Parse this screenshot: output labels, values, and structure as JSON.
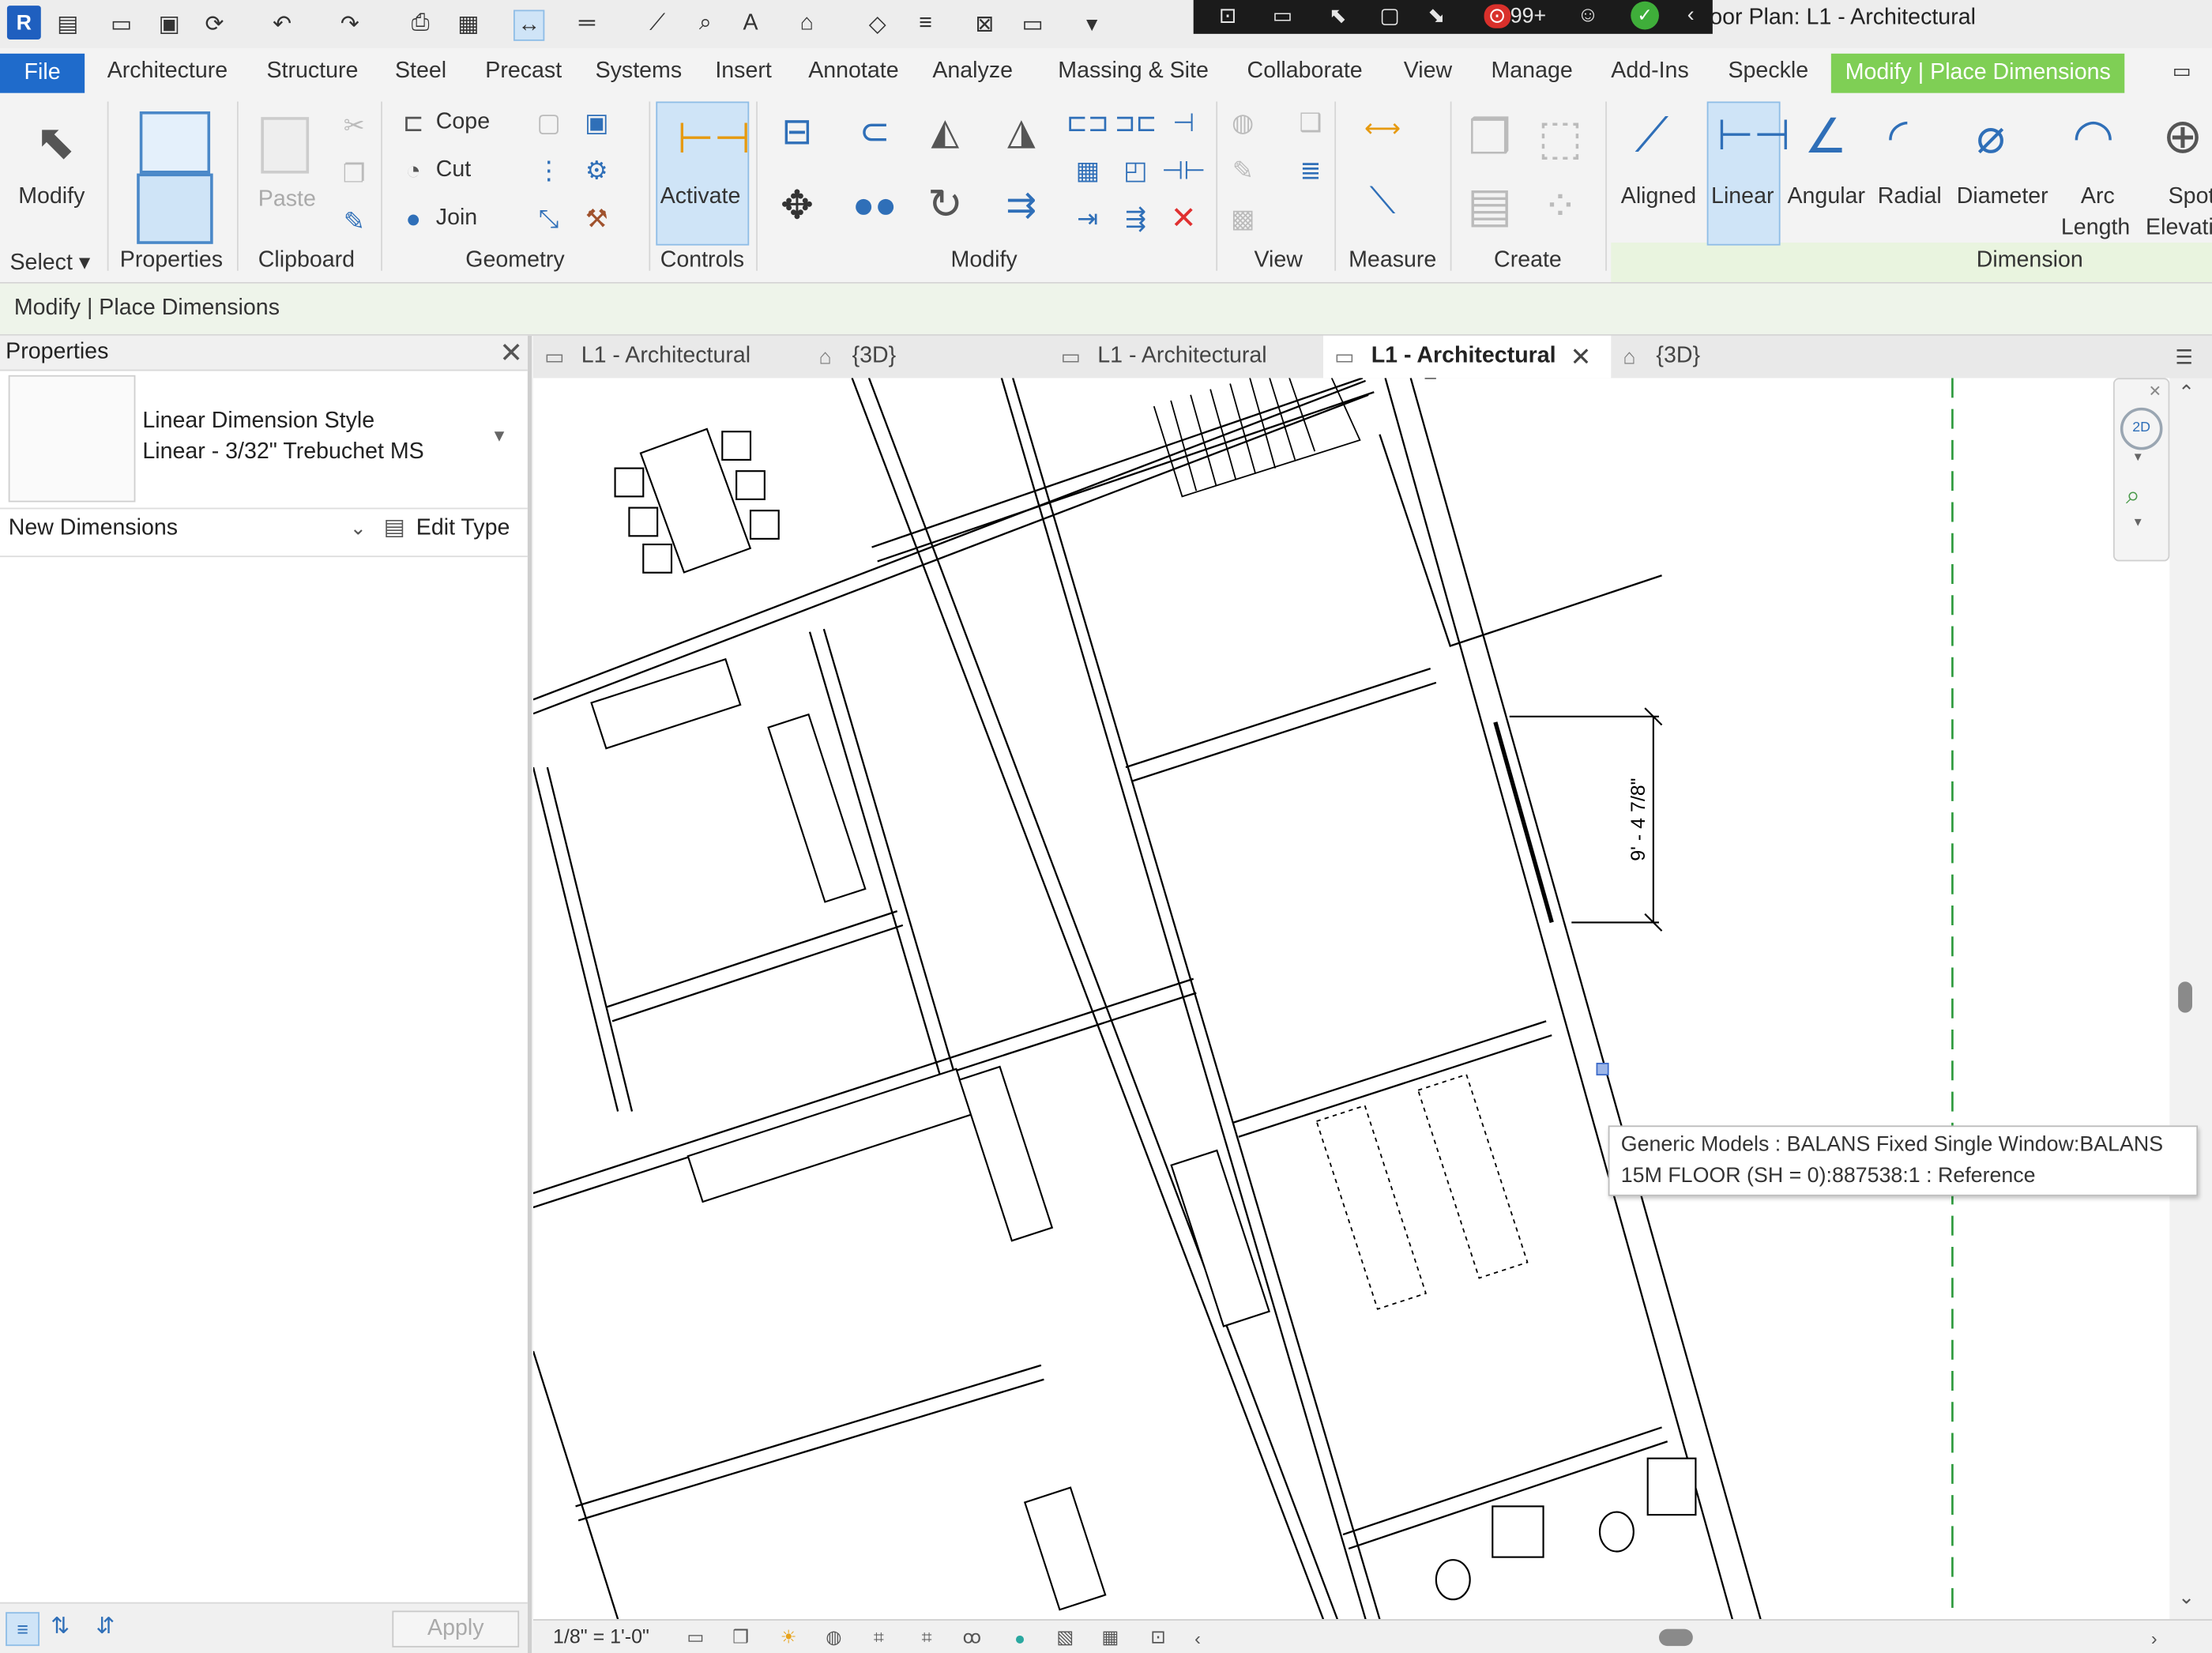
{
  "app": {
    "logo": "R",
    "window_title": "oor Plan: L1 - Architectural"
  },
  "quick_access": {
    "icons": [
      "home-icon",
      "open-icon",
      "open-folder-icon",
      "save-icon",
      "sync-icon",
      "undo-icon",
      "redo-icon",
      "print-icon",
      "print-view-icon",
      "measure-icon",
      "align-dimension-icon",
      "tag-icon",
      "detail-line-icon",
      "text-icon",
      "3d-view-icon",
      "section-icon",
      "thin-lines-icon",
      "close-hidden-icon",
      "switch-windows-icon",
      "customize-icon"
    ],
    "notification_badge": "99+"
  },
  "ribbon_tabs": {
    "file": "File",
    "items": [
      "Architecture",
      "Structure",
      "Steel",
      "Precast",
      "Systems",
      "Insert",
      "Annotate",
      "Analyze",
      "Massing & Site",
      "Collaborate",
      "View",
      "Manage",
      "Add-Ins",
      "Speckle"
    ],
    "contextual": "Modify | Place Dimensions"
  },
  "ribbon": {
    "select": {
      "modify": "Modify",
      "panel": "Select"
    },
    "properties": {
      "panel": "Properties"
    },
    "clipboard": {
      "paste": "Paste",
      "panel": "Clipboard"
    },
    "geometry": {
      "cope": "Cope",
      "cut": "Cut",
      "join": "Join",
      "panel": "Geometry"
    },
    "controls": {
      "activate": "Activate",
      "panel": "Controls"
    },
    "modify_panel": {
      "panel": "Modify"
    },
    "view_panel": {
      "panel": "View"
    },
    "measure": {
      "panel": "Measure"
    },
    "create": {
      "panel": "Create"
    },
    "dimension": {
      "panel": "Dimension",
      "tools": [
        {
          "label": "Aligned"
        },
        {
          "label": "Linear",
          "active": true
        },
        {
          "label": "Angular"
        },
        {
          "label": "Radial"
        },
        {
          "label": "Diameter"
        },
        {
          "label": "Arc",
          "label2": "Length"
        },
        {
          "label": "Spot",
          "label2": "Elevati"
        }
      ]
    }
  },
  "options_bar": {
    "text": "Modify | Place Dimensions"
  },
  "properties": {
    "title": "Properties",
    "type_family": "Linear Dimension Style",
    "type_name": "Linear - 3/32\" Trebuchet MS",
    "filter": "New Dimensions",
    "edit_type": "Edit Type",
    "apply": "Apply"
  },
  "view_tabs": [
    {
      "label": "L1 - Architectural",
      "icon": "floor-plan-icon",
      "active": false
    },
    {
      "label": "{3D}",
      "icon": "3d-home-icon",
      "active": false
    },
    {
      "label": "L1 - Architectural",
      "icon": "floor-plan-icon",
      "active": false
    },
    {
      "label": "L1 - Architectural",
      "icon": "floor-plan-icon",
      "active": true
    },
    {
      "label": "{3D}",
      "icon": "3d-home-icon",
      "active": false
    }
  ],
  "canvas": {
    "dimension_text": "9' - 4 7/8\"",
    "tooltip_line1": "Generic Models : BALANS Fixed Single Window:BALANS",
    "tooltip_line2": "15M FLOOR (SH = 0):887538:1 : Reference"
  },
  "status_bar": {
    "scale": "1/8\" = 1'-0\""
  },
  "colors": {
    "accent_blue": "#1f6bcb",
    "contextual_green": "#7fcf55",
    "grid_dash": "#2e9a3e"
  }
}
